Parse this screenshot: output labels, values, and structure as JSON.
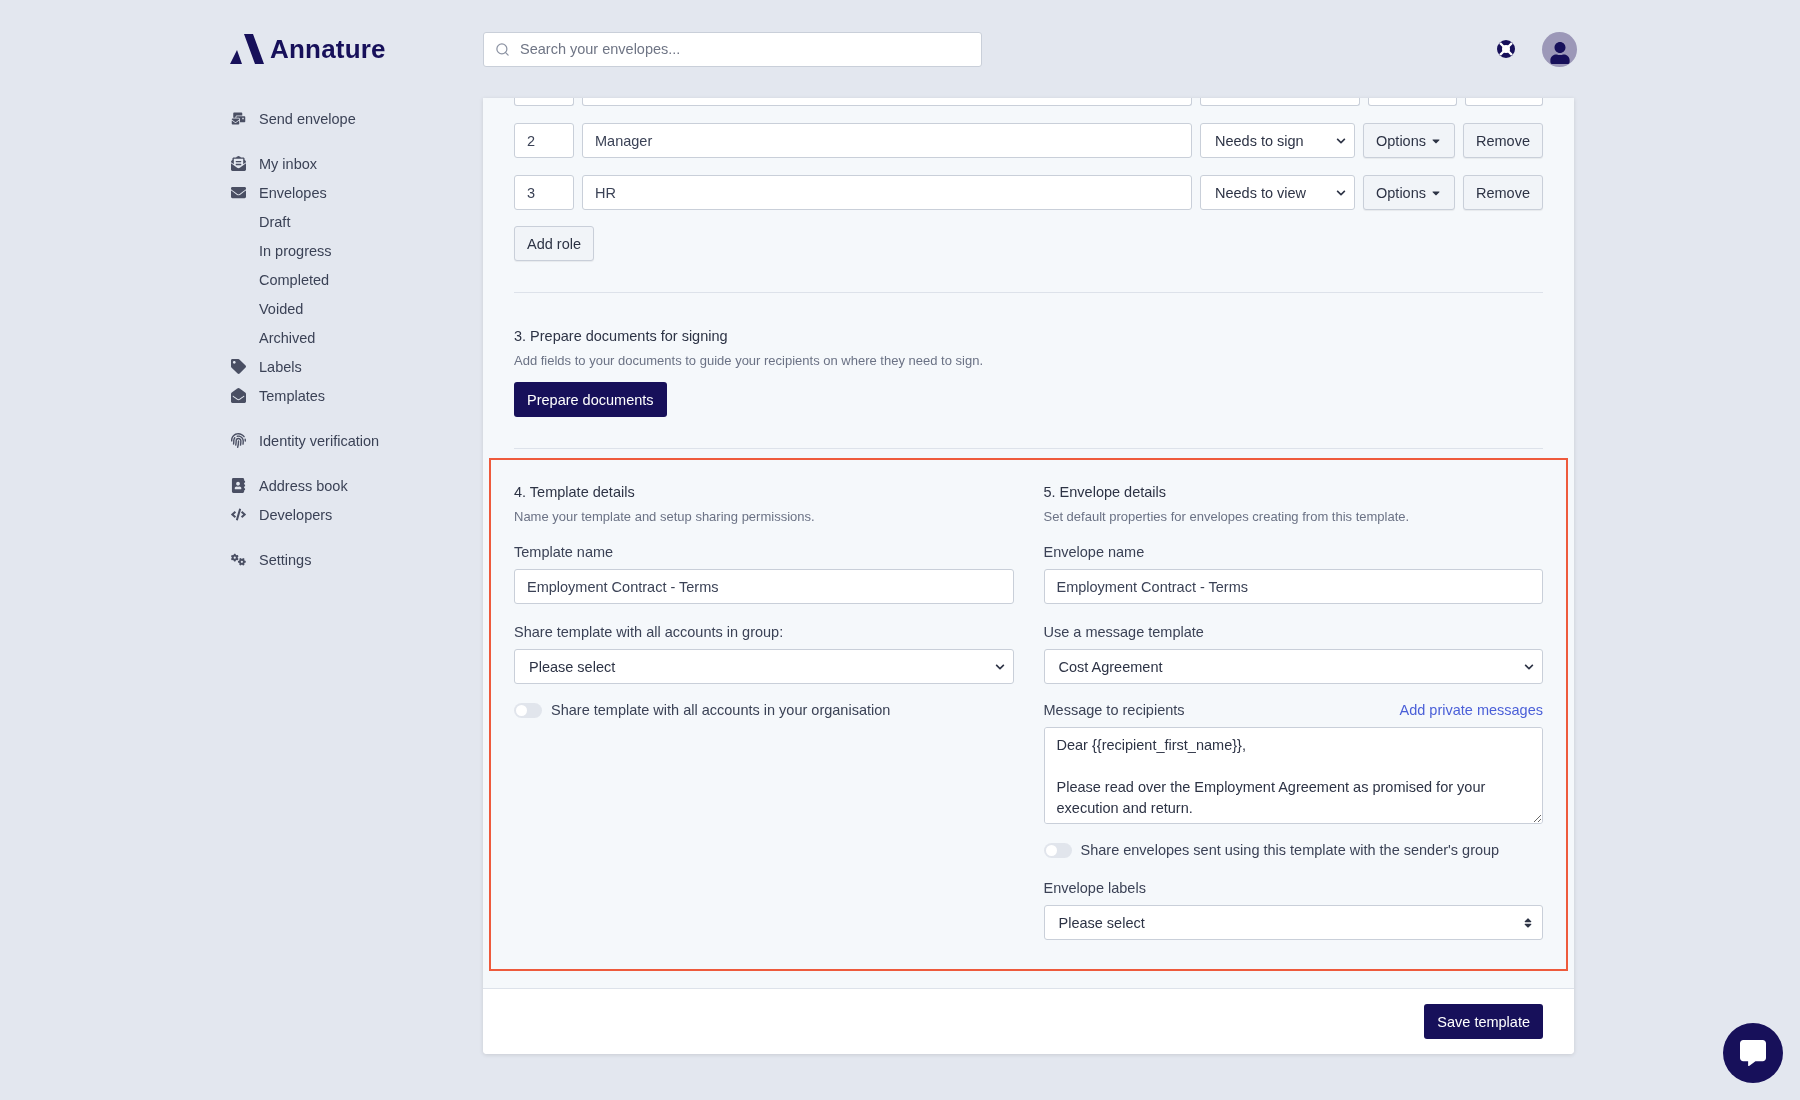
{
  "brand": {
    "name": "Annature"
  },
  "search": {
    "placeholder": "Search your envelopes..."
  },
  "sidebar": {
    "groups": [
      [
        {
          "label": "Send envelope",
          "selected": false
        }
      ],
      [
        {
          "label": "My inbox",
          "selected": false
        },
        {
          "label": "Envelopes",
          "selected": false,
          "children": [
            {
              "label": "Draft",
              "selected": false
            },
            {
              "label": "In progress",
              "selected": false
            },
            {
              "label": "Completed",
              "selected": false
            },
            {
              "label": "Voided",
              "selected": false
            },
            {
              "label": "Archived",
              "selected": false
            }
          ]
        },
        {
          "label": "Labels",
          "selected": false
        },
        {
          "label": "Templates",
          "selected": false
        }
      ],
      [
        {
          "label": "Identity verification",
          "selected": false
        }
      ],
      [
        {
          "label": "Address book",
          "selected": false
        },
        {
          "label": "Developers",
          "selected": false
        }
      ],
      [
        {
          "label": "Settings",
          "selected": false
        }
      ]
    ]
  },
  "roles": [
    {
      "order": "2",
      "name": "Manager",
      "action": "Needs to sign",
      "options": "Options",
      "remove": "Remove"
    },
    {
      "order": "3",
      "name": "HR",
      "action": "Needs to view",
      "options": "Options",
      "remove": "Remove"
    }
  ],
  "add_role": "Add role",
  "prepare": {
    "title": "3. Prepare documents for signing",
    "description": "Add fields to your documents to guide your recipients on where they need to sign.",
    "button": "Prepare documents"
  },
  "template_details": {
    "title": "4. Template details",
    "description": "Name your template and setup sharing permissions.",
    "name_label": "Template name",
    "name_value": "Employment Contract - Terms",
    "group_label": "Share template with all accounts in group:",
    "group_value": "Please select",
    "org_toggle": {
      "label": "Share template with all accounts in your organisation",
      "on": false
    }
  },
  "envelope_details": {
    "title": "5. Envelope details",
    "description": "Set default properties for envelopes creating from this template.",
    "name_label": "Envelope name",
    "name_value": "Employment Contract - Terms",
    "message_template_label": "Use a message template",
    "message_template_value": "Cost Agreement",
    "message_label": "Message to recipients",
    "private_link": "Add private messages",
    "message_value": "Dear {{recipient_first_name}},\n\nPlease read over the Employment Agreement as promised for your execution and return.",
    "group_toggle": {
      "label": "Share envelopes sent using this template with the sender's group",
      "on": false
    },
    "labels_label": "Envelope labels",
    "labels_value": "Please select"
  },
  "save_button": "Save template"
}
